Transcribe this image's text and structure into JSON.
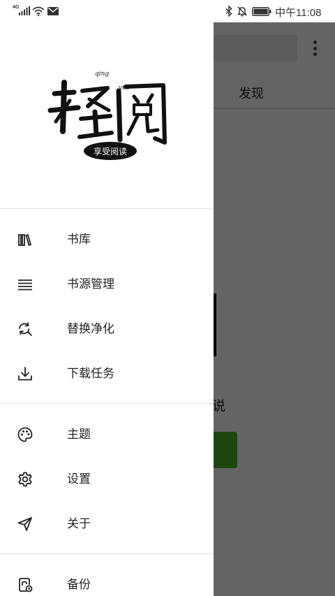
{
  "status_bar": {
    "network": "4G",
    "time": "中午11:08",
    "icons": [
      "signal-icon",
      "wifi-icon",
      "mail-icon",
      "bluetooth-icon",
      "mute-icon",
      "battery-icon"
    ]
  },
  "background": {
    "tab_discover": "发现",
    "partial_text": "说"
  },
  "drawer": {
    "logo": {
      "title": "轻阅",
      "pinyin_left": "qing",
      "pinyin_right": "yue",
      "stamp": "享受阅读"
    },
    "groups": [
      [
        {
          "icon": "bookshelf-icon",
          "label": "书库"
        },
        {
          "icon": "list-icon",
          "label": "书源管理"
        },
        {
          "icon": "replace-search-icon",
          "label": "替换净化"
        },
        {
          "icon": "download-icon",
          "label": "下载任务"
        }
      ],
      [
        {
          "icon": "palette-icon",
          "label": "主题"
        },
        {
          "icon": "settings-icon",
          "label": "设置"
        },
        {
          "icon": "send-icon",
          "label": "关于"
        }
      ],
      [
        {
          "icon": "backup-icon",
          "label": "备份"
        }
      ]
    ]
  },
  "colors": {
    "scrim": "#666666",
    "accent_green": "#4caf2a",
    "text": "#222222"
  }
}
